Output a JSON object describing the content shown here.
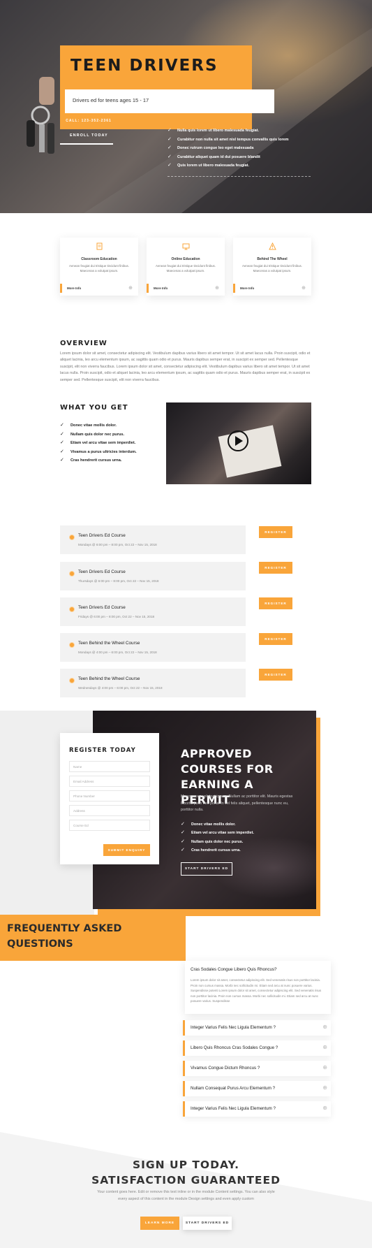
{
  "hero": {
    "title": "TEEN DRIVERS",
    "subtitle": "Drivers ed for teens ages 15 - 17",
    "call_label": "CALL: 123-352-2361",
    "enroll_label": "ENROLL TODAY",
    "checklist": [
      "Nulla quis lorem ut libero malesuada feugiat.",
      "Curabitur non nulla sit amet nisl tempus convallis quis lorem",
      "Donec rutrum congue leo eget malesuada",
      "Curabitur aliquet quam id dui posuere blandit",
      "Quis lorem ut libero malesuada feugiat."
    ]
  },
  "cards": [
    {
      "title": "Classroom Education",
      "text": "Aenean feugiat dui tristique tincidunt finibus. Maecenas a volutpat ipsum.",
      "more": "More Info",
      "icon": "document-icon"
    },
    {
      "title": "Online Education",
      "text": "Aenean feugiat dui tristique tincidunt finibus. Maecenas a volutpat ipsum.",
      "more": "More Info",
      "icon": "monitor-icon"
    },
    {
      "title": "Behind The Wheel",
      "text": "Aenean feugiat dui tristique tincidunt finibus. Maecenas a volutpat ipsum.",
      "more": "More Info",
      "icon": "warning-icon"
    }
  ],
  "overview": {
    "title": "OVERVIEW",
    "text": "Lorem ipsum dolor sit amet, consectetur adipiscing elit. Vestibulum dapibus varius libero sit amet tempor. Ut sit amet lacus nulla. Proin suscipit, odio et aliquet lacinia, leo arcu elementum ipsum, ac sagittis quam odio et purus. Mauris dapibus semper erat, in suscipit ex semper sed. Pellentesque suscipit, elit non viverra faucibus. Lorem ipsum dolor sit amet, consectetur adipiscing elit. Vestibulum dapibus varius libero sit amet tempor. Ut sit amet lacus nulla. Proin suscipit, odio et aliquet lacinia, leo arcu elementum ipsum, ac sagittis quam odio et purus. Mauris dapibus semper erat, in suscipit ex semper sed. Pellentesque suscipit, elit non viverra faucibus."
  },
  "what_you_get": {
    "title": "WHAT YOU GET",
    "items": [
      "Donec vitae mollis dolor.",
      "Nullam quis dolor nec purus.",
      "Etiam vel arcu vitae sem imperdiet.",
      "Vivamus a purus ultricies interdum.",
      "Cras hendrerit cursus urna."
    ]
  },
  "courses": [
    {
      "title": "Teen Drivers Ed Course",
      "date": "Mondays @ 6:00 pm – 8:00 pm, Oct 22 – Nov 15, 2018",
      "button": "REGISTER"
    },
    {
      "title": "Teen Drivers Ed Course",
      "date": "Thursdays @ 6:00 pm – 8:00 pm, Oct 22 – Nov 15, 2018",
      "button": "REGISTER"
    },
    {
      "title": "Teen Drivers Ed Course",
      "date": "Fridays @ 6:00 pm – 8:00 pm, Oct 22 – Nov 15, 2018",
      "button": "REGISTER"
    },
    {
      "title": "Teen Behind the Wheel Course",
      "date": "Mondays @ 4:00 pm – 6:00 pm, Oct 22 – Nov 15, 2018",
      "button": "REGISTER"
    },
    {
      "title": "Teen Behind the Wheel Course",
      "date": "Wednesdays @ 4:00 pm – 6:00 pm, Oct 22 – Nov 15, 2018",
      "button": "REGISTER"
    }
  ],
  "register": {
    "title": "REGISTER TODAY",
    "fields": [
      "Name",
      "Email Address",
      "Phone Number",
      "Address",
      "Course Ed"
    ],
    "submit": "SUBMIT ENQUIRY"
  },
  "approved": {
    "title": "APPROVED COURSES FOR EARNING A PERMIT",
    "text": "Maecenas a volutpat ipsum. Nullam ac porttitor elit. Mauris egestas lobortis justo nec porta. In vel felis aliquet, pellentesque nunc eu, porttitor nulla.",
    "items": [
      "Donec vitae mollis dolor.",
      "Etiam vel arcu vitae sem imperdiet.",
      "Nullam quis dolor nec purus.",
      "Cras hendrerit cursus urna."
    ],
    "button": "START DRIVERS ED"
  },
  "faq": {
    "title": "FREQUENTLY ASKED QUESTIONS",
    "open_question": "Cras Sodales Congue Libero Quis Rhoncus?",
    "open_answer": "Lorem ipsum dolor sit amet, consectetur adipiscing elit. Sed venenatis risus non porttitor lacinia. Proin non cursus massa. Morbi nec sollicitudin mi. Etiam sed arcu at nunc posuere varius. Suspendisse potenti Lorem ipsum dolor sit amet, consectetur adipiscing elit. Sed venenatis risus non porttitor lacinia. Proin non cursus massa. Morbi nec sollicitudin mi. Etiam sed arcu at nunc posuere varius. Suspendisse",
    "questions": [
      "Integer Varius Felis Nec Ligula Elementum ?",
      "Libero Quis Rhoncus Cras Sodales Congue ?",
      "Vivamus Congue Dictum Rhoncus ?",
      "Nullam Consequat Purus Arcu Elementum ?",
      "Integer Varius Felis Nec Ligula Elementum ?"
    ]
  },
  "signup": {
    "title_line1": "SIGN UP TODAY.",
    "title_line2": "SATISFACTION GUARANTEED",
    "text": "Your content goes here. Edit or remove this text inline or in the module Content settings. You can also style every aspect of this content in the module Design settings and even apply custom",
    "learn_more": "LEARN MORE",
    "start": "START DRIVERS ED"
  },
  "colors": {
    "accent": "#f9a53a",
    "dark": "#222222"
  }
}
